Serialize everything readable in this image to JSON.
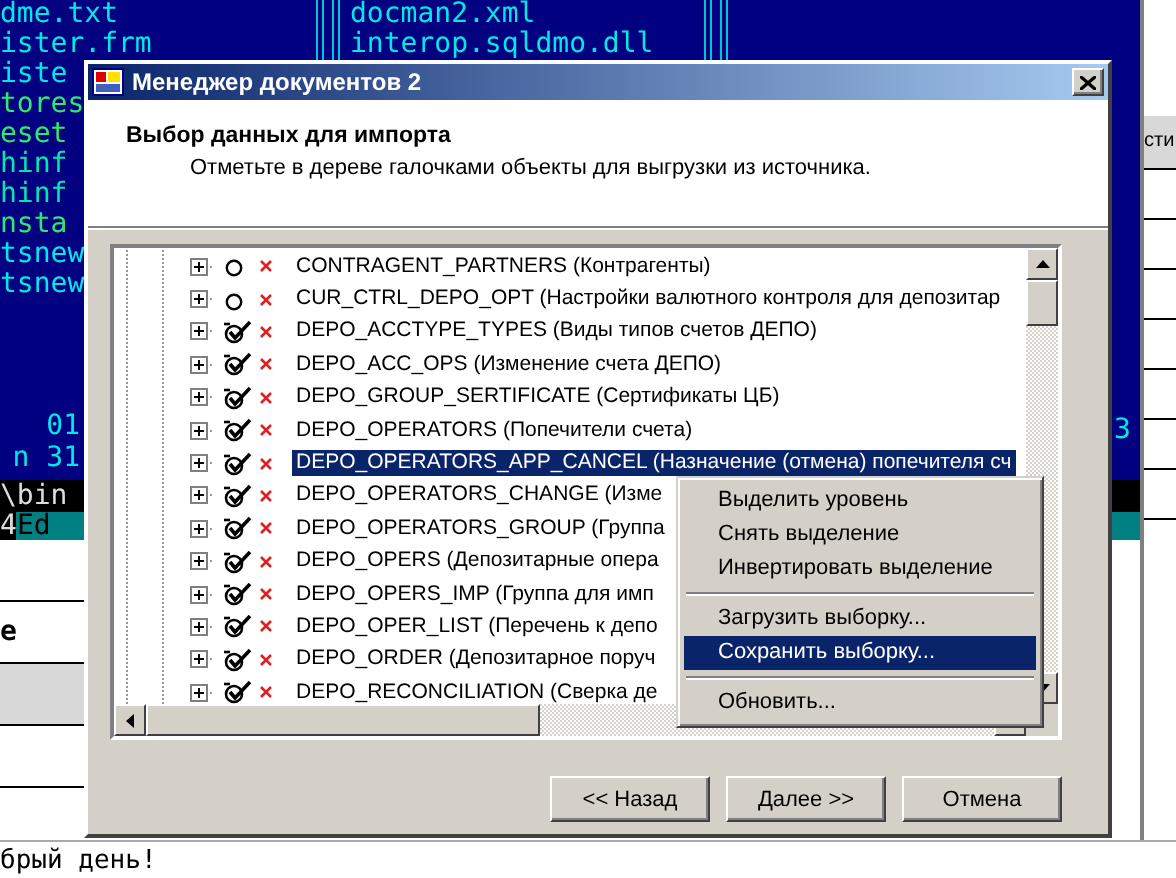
{
  "console": {
    "left_files": [
      {
        "name": "dme.txt",
        "color": "#00e8e8"
      },
      {
        "name": "ister.frm",
        "color": "#00e8e8"
      },
      {
        "name": "iste",
        "color": "#00e8e8"
      },
      {
        "name": "tores",
        "color": "#30e870"
      },
      {
        "name": "eset",
        "color": "#30e870"
      },
      {
        "name": "hinf",
        "color": "#00e8b0"
      },
      {
        "name": "hinf",
        "color": "#00e8b0"
      },
      {
        "name": "nsta",
        "color": "#30e870"
      },
      {
        "name": "tsnew",
        "color": "#00e8e8"
      },
      {
        "name": "tsnew",
        "color": "#00e8e8"
      }
    ],
    "right_files": [
      "docman2.xml",
      "interop.sqldmo.dll"
    ],
    "left_info": [
      "01",
      "n 31"
    ],
    "right_info": "3",
    "path": "\\bin",
    "key_number": "4",
    "key_label": "Ed"
  },
  "right_window": {
    "header": "сти"
  },
  "left_window": {
    "cell": "e"
  },
  "console_line": "брый день!",
  "dialog": {
    "title": "Менеджер документов 2",
    "heading": "Выбор данных для импорта",
    "subtitle": "Отметьте в дереве галочками объекты для выгрузки из источника.",
    "rows": [
      {
        "text": "CONTRAGENT_PARTNERS (Контрагенты)",
        "checked": false,
        "selected": false
      },
      {
        "text": "CUR_CTRL_DEPO_OPT (Настройки валютного контроля для депозитар",
        "checked": false,
        "selected": false
      },
      {
        "text": "DEPO_ACCTYPE_TYPES (Виды типов счетов ДЕПО)",
        "checked": true,
        "selected": false
      },
      {
        "text": "DEPO_ACC_OPS (Изменение счета ДЕПО)",
        "checked": true,
        "selected": false
      },
      {
        "text": "DEPO_GROUP_SERTIFICATE (Сертификаты ЦБ)",
        "checked": true,
        "selected": false
      },
      {
        "text": "DEPO_OPERATORS (Попечители счета)",
        "checked": true,
        "selected": false
      },
      {
        "text": "DEPO_OPERATORS_APP_CANCEL (Назначение (отмена) попечителя сч",
        "checked": true,
        "selected": true
      },
      {
        "text": "DEPO_OPERATORS_CHANGE (Изме",
        "checked": true,
        "selected": false
      },
      {
        "text": "DEPO_OPERATORS_GROUP (Группа",
        "checked": true,
        "selected": false
      },
      {
        "text": "DEPO_OPERS (Депозитарные опера",
        "checked": true,
        "selected": false
      },
      {
        "text": "DEPO_OPERS_IMP (Группа для имп",
        "checked": true,
        "selected": false
      },
      {
        "text": "DEPO_OPER_LIST (Перечень к депо",
        "checked": true,
        "selected": false
      },
      {
        "text": "DEPO_ORDER (Депозитарное поруч",
        "checked": true,
        "selected": false
      },
      {
        "text": "DEPO_RECONCILIATION (Сверка де",
        "checked": true,
        "selected": false
      }
    ],
    "context_menu": [
      {
        "kind": "item",
        "label": "Выделить уровень",
        "selected": false
      },
      {
        "kind": "item",
        "label": "Снять выделение",
        "selected": false
      },
      {
        "kind": "item",
        "label": "Инвертировать выделение",
        "selected": false
      },
      {
        "kind": "separator"
      },
      {
        "kind": "item",
        "label": "Загрузить выборку...",
        "selected": false
      },
      {
        "kind": "item",
        "label": "Сохранить выборку...",
        "selected": true
      },
      {
        "kind": "separator"
      },
      {
        "kind": "item",
        "label": "Обновить...",
        "selected": false
      }
    ],
    "buttons": [
      "<< Назад",
      "Далее >>",
      "Отмена"
    ]
  }
}
